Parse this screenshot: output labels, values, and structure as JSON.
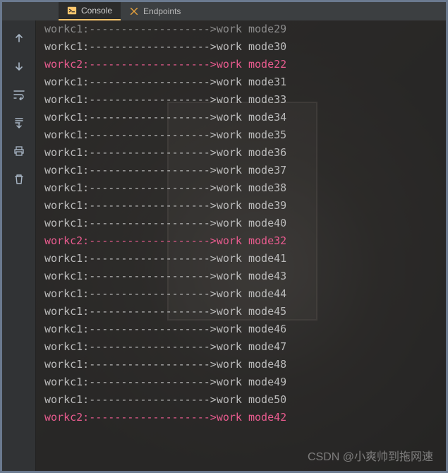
{
  "tabs": {
    "console": {
      "label": "Console"
    },
    "endpoints": {
      "label": "Endpoints"
    }
  },
  "gutter": {
    "up": "arrow-up-icon",
    "down": "arrow-down-icon",
    "wrap": "soft-wrap-icon",
    "scroll": "scroll-to-end-icon",
    "print": "print-icon",
    "clear": "clear-all-icon"
  },
  "lines": [
    {
      "text": "workc1:------------------->work mode29",
      "cls": "first"
    },
    {
      "text": "workc1:------------------->work mode30",
      "cls": ""
    },
    {
      "text": "workc2:------------------->work mode22",
      "cls": "hl"
    },
    {
      "text": "workc1:------------------->work mode31",
      "cls": ""
    },
    {
      "text": "workc1:------------------->work mode33",
      "cls": ""
    },
    {
      "text": "workc1:------------------->work mode34",
      "cls": ""
    },
    {
      "text": "workc1:------------------->work mode35",
      "cls": ""
    },
    {
      "text": "workc1:------------------->work mode36",
      "cls": ""
    },
    {
      "text": "workc1:------------------->work mode37",
      "cls": ""
    },
    {
      "text": "workc1:------------------->work mode38",
      "cls": ""
    },
    {
      "text": "workc1:------------------->work mode39",
      "cls": ""
    },
    {
      "text": "workc1:------------------->work mode40",
      "cls": ""
    },
    {
      "text": "workc2:------------------->work mode32",
      "cls": "hl"
    },
    {
      "text": "workc1:------------------->work mode41",
      "cls": ""
    },
    {
      "text": "workc1:------------------->work mode43",
      "cls": ""
    },
    {
      "text": "workc1:------------------->work mode44",
      "cls": ""
    },
    {
      "text": "workc1:------------------->work mode45",
      "cls": ""
    },
    {
      "text": "workc1:------------------->work mode46",
      "cls": ""
    },
    {
      "text": "workc1:------------------->work mode47",
      "cls": ""
    },
    {
      "text": "workc1:------------------->work mode48",
      "cls": ""
    },
    {
      "text": "workc1:------------------->work mode49",
      "cls": ""
    },
    {
      "text": "workc1:------------------->work mode50",
      "cls": ""
    },
    {
      "text": "workc2:------------------->work mode42",
      "cls": "hl"
    }
  ],
  "watermark": "CSDN @小爽帅到拖网速"
}
